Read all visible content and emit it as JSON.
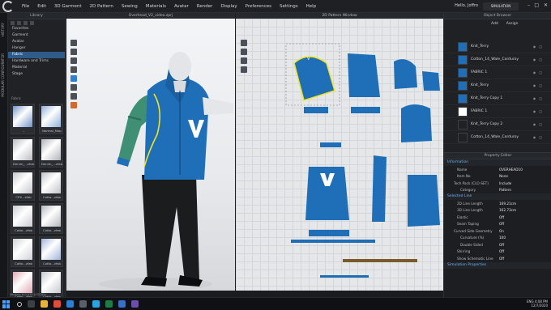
{
  "menu": [
    "File",
    "Edit",
    "3D Garment",
    "2D Pattern",
    "Sewing",
    "Materials",
    "Avatar",
    "Render",
    "Display",
    "Preferences",
    "Settings",
    "Help"
  ],
  "user": "Hello, Joffro",
  "sim_badge": "SIMULATION",
  "window_controls": [
    "–",
    "□",
    "✕"
  ],
  "left_rail": [
    "HISTORY",
    "MODULAR CONFIGURATOR"
  ],
  "library": {
    "title": "Library",
    "items": [
      "Favorites",
      "Garment",
      "Avatar",
      "Hanger",
      "Fabric",
      "Hardware and Trims",
      "Material",
      "Stage"
    ],
    "active_index": 4,
    "breadcrumb": "Fabric",
    "thumbs": [
      {
        "caption": "..",
        "color": "#6f93c7"
      },
      {
        "caption": "Normal_Map",
        "color": "#8fb0d8"
      },
      {
        "caption": "Denim_...zfab",
        "color": "#b9bcc2"
      },
      {
        "caption": "Denim_...zfab",
        "color": "#aeb2b8"
      },
      {
        "caption": "CPX...zfab",
        "color": "#c5c8cd"
      },
      {
        "caption": "Cotto...zfab",
        "color": "#bfc3c9"
      },
      {
        "caption": "Cotto...zfab",
        "color": "#c9ccd1"
      },
      {
        "caption": "Cotto...zfab",
        "color": "#b4b8be"
      },
      {
        "caption": "Cotto...zfab",
        "color": "#cfd2d6"
      },
      {
        "caption": "Cotto...zfab",
        "color": "#9fb4d8"
      },
      {
        "caption": "Cotto...zfab",
        "color": "#e0a9b3"
      },
      {
        "caption": "Cotto...zfab",
        "color": "#c6c9ce"
      }
    ],
    "version": "Version: 6.0.279 (r32285)"
  },
  "view3d": {
    "title": "Overhead_V2_video.zprj"
  },
  "view2d": {
    "title": "2D Pattern Window"
  },
  "object_browser": {
    "title": "Object Browser",
    "add": "Add",
    "assign": "Assign",
    "items": [
      {
        "name": "Knit_Terry",
        "color": "#1f6fb8"
      },
      {
        "name": "Cotton_14_Wale_Corduroy",
        "color": "#1f6fb8"
      },
      {
        "name": "FABRIC 1",
        "color": "#1f6fb8"
      },
      {
        "name": "Knit_Terry",
        "color": "#1f6fb8"
      },
      {
        "name": "Knit_Terry Copy 1",
        "color": "#1f6fb8"
      },
      {
        "name": "FABRIC 1",
        "color": "#ffffff"
      },
      {
        "name": "Knit_Terry Copy 2",
        "color": "#1f2125"
      },
      {
        "name": "Cotton_14_Wale_Corduroy",
        "color": "#1f2125"
      }
    ]
  },
  "property_editor": {
    "title": "Property Editor",
    "information": "Information",
    "name_k": "Name",
    "name_v": "OVERHEAD10",
    "item_k": "Item No",
    "item_v": "None",
    "tech_pack_k": "Tech Pack (CLO-SET)",
    "tech_pack_v": "Include",
    "category_k": "Category",
    "category_v": "Pattern",
    "selected_line": "Selected Line",
    "line_length_k": "2D Line Length",
    "line_length_v": "169.21cm",
    "line_length3d_k": "3D Line Length",
    "line_length3d_v": "162.73cm",
    "elastic_k": "Elastic",
    "elastic_v": "Off",
    "seam_taping_k": "Seam Taping",
    "seam_taping_v": "Off",
    "curved_k": "Curved Side Geometry",
    "curved_v": "On",
    "curvature_k": "Curvature (%)",
    "curvature_v": "100",
    "double_k": "Double Sided",
    "double_v": "Off",
    "shirring_k": "Shirring",
    "shirring_v": "Off",
    "schematic_k": "Show Schematic Line",
    "schematic_v": "Off",
    "sim_props": "Simulation Properties"
  },
  "taskbar": {
    "time": "4:08 PM",
    "date": "12/7/2020",
    "lang": "ENG"
  },
  "colors": {
    "accent": "#2f5b8a",
    "garment_blue": "#1f6fb8",
    "sleeve_green": "#3e8f74",
    "selection_yellow": "#f4e31e"
  }
}
